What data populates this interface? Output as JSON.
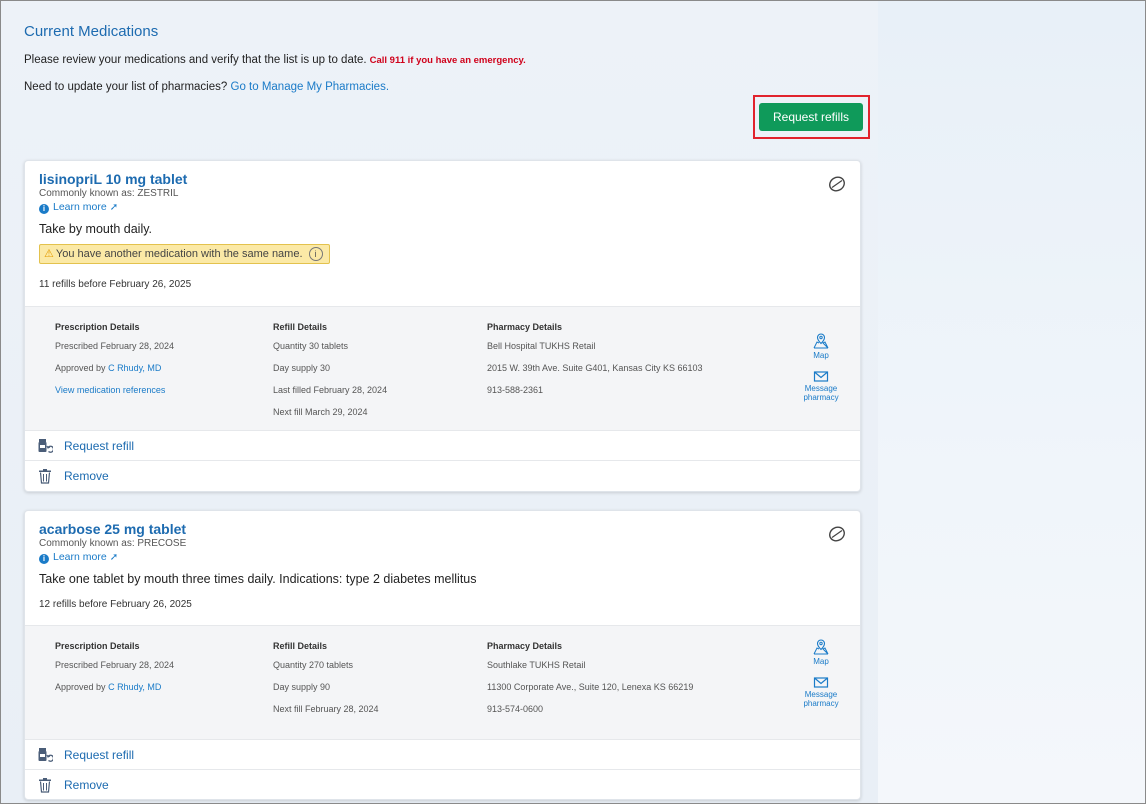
{
  "page": {
    "title": "Current Medications",
    "intro_text": "Please review your medications and verify that the list is up to date.",
    "emergency_text": "Call 911 if you have an emergency.",
    "pharmacy_question": "Need to update your list of pharmacies?",
    "pharmacy_link": "Go to Manage My Pharmacies.",
    "request_refills_label": "Request refills"
  },
  "colors": {
    "accent": "#1d6bb0",
    "button_green": "#0f9a5a",
    "highlight_red": "#e1232d",
    "emergency_red": "#d0021b",
    "warning_bg": "#fbe9a6"
  },
  "medications": [
    {
      "name": "lisinopriL 10 mg tablet",
      "known_as": "Commonly known as: ZESTRIL",
      "learn_more": "Learn more",
      "instructions": "Take by mouth daily.",
      "warning": "You have another medication with the same name.",
      "refills": "11 refills before February 26, 2025",
      "prescription": {
        "header": "Prescription Details",
        "prescribed": "Prescribed February 28, 2024",
        "approved_prefix": "Approved by",
        "approved_by": "C Rhudy, MD",
        "references_link": "View medication references"
      },
      "refill": {
        "header": "Refill Details",
        "quantity": "Quantity 30 tablets",
        "supply": "Day supply 30",
        "last_filled": "Last filled February 28, 2024",
        "next_fill": "Next fill March 29, 2024"
      },
      "pharmacy": {
        "header": "Pharmacy Details",
        "name": "Bell Hospital TUKHS Retail",
        "address": "2015 W. 39th Ave. Suite G401, Kansas City KS 66103",
        "phone": "913-588-2361"
      },
      "map_label": "Map",
      "message_label_1": "Message",
      "message_label_2": "pharmacy",
      "request_refill_label": "Request refill",
      "remove_label": "Remove"
    },
    {
      "name": "acarbose 25 mg tablet",
      "known_as": "Commonly known as: PRECOSE",
      "learn_more": "Learn more",
      "instructions": "Take one tablet by mouth three times daily. Indications: type 2 diabetes mellitus",
      "refills": "12 refills before February 26, 2025",
      "prescription": {
        "header": "Prescription Details",
        "prescribed": "Prescribed February 28, 2024",
        "approved_prefix": "Approved by",
        "approved_by": "C Rhudy, MD"
      },
      "refill": {
        "header": "Refill Details",
        "quantity": "Quantity 270 tablets",
        "supply": "Day supply 90",
        "next_fill": "Next fill February 28, 2024"
      },
      "pharmacy": {
        "header": "Pharmacy Details",
        "name": "Southlake TUKHS Retail",
        "address": "11300 Corporate Ave., Suite 120, Lenexa KS 66219",
        "phone": "913-574-0600"
      },
      "map_label": "Map",
      "message_label_1": "Message",
      "message_label_2": "pharmacy",
      "request_refill_label": "Request refill",
      "remove_label": "Remove"
    }
  ]
}
